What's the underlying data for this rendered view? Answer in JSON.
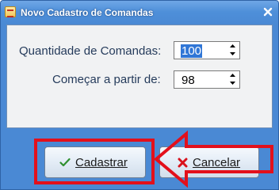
{
  "window": {
    "title": "Novo Cadastro de Comandas"
  },
  "form": {
    "quantity_label": "Quantidade de Comandas:",
    "quantity_value": "100",
    "start_label": "Começar a partir de:",
    "start_value": "98"
  },
  "buttons": {
    "register_label": "Cadastrar",
    "cancel_label": "Cancelar"
  },
  "annotation": {
    "highlight_color": "#e3101b"
  },
  "colors": {
    "titlebar": "#4a89d4",
    "label_text": "#253b5b",
    "selection": "#3076d6"
  },
  "icons": [
    "app-icon",
    "close-icon",
    "spin-up-icon",
    "spin-down-icon",
    "check-icon",
    "x-icon",
    "arrow-left-icon"
  ]
}
